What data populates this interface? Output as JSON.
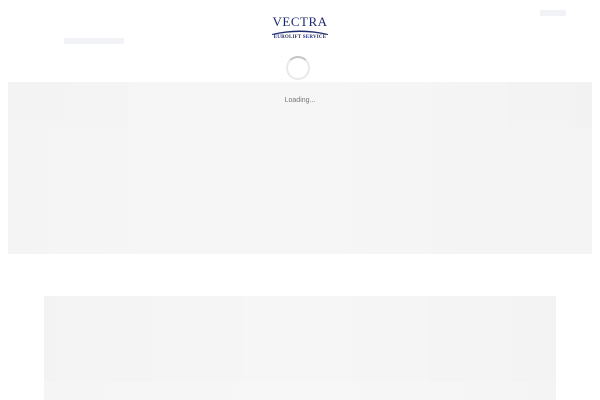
{
  "logo": {
    "title": "VECTRA",
    "subtitle": "EUROLIFT SERVICE"
  },
  "loader": {
    "text": "Loading..."
  },
  "colors": {
    "brand": "#1f2a6b",
    "background": "#ffffff",
    "loading_text": "#777777",
    "spinner_track": "#e9e9e9",
    "spinner_arc": "#c4c4c4"
  },
  "icons": {
    "spinner": "loading-spinner-icon"
  }
}
